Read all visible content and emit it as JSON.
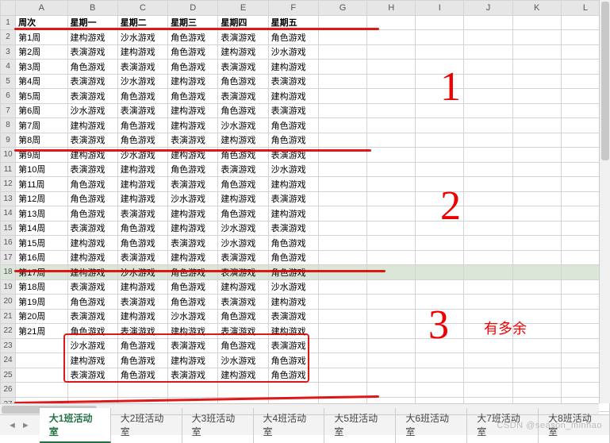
{
  "cols": [
    "",
    "A",
    "B",
    "C",
    "D",
    "E",
    "F",
    "G",
    "H",
    "I",
    "J",
    "K",
    "L"
  ],
  "hdr": {
    "A": "周次",
    "B": "星期一",
    "C": "星期二",
    "D": "星期三",
    "E": "星期四",
    "F": "星期五"
  },
  "rows": [
    {
      "n": 2,
      "A": "第1周",
      "B": "建构游戏",
      "C": "沙水游戏",
      "D": "角色游戏",
      "E": "表演游戏",
      "F": "角色游戏"
    },
    {
      "n": 3,
      "A": "第2周",
      "B": "表演游戏",
      "C": "建构游戏",
      "D": "角色游戏",
      "E": "建构游戏",
      "F": "沙水游戏"
    },
    {
      "n": 4,
      "A": "第3周",
      "B": "角色游戏",
      "C": "表演游戏",
      "D": "角色游戏",
      "E": "表演游戏",
      "F": "建构游戏"
    },
    {
      "n": 5,
      "A": "第4周",
      "B": "表演游戏",
      "C": "沙水游戏",
      "D": "建构游戏",
      "E": "角色游戏",
      "F": "表演游戏"
    },
    {
      "n": 6,
      "A": "第5周",
      "B": "表演游戏",
      "C": "角色游戏",
      "D": "角色游戏",
      "E": "表演游戏",
      "F": "建构游戏"
    },
    {
      "n": 7,
      "A": "第6周",
      "B": "沙水游戏",
      "C": "表演游戏",
      "D": "建构游戏",
      "E": "角色游戏",
      "F": "表演游戏"
    },
    {
      "n": 8,
      "A": "第7周",
      "B": "建构游戏",
      "C": "角色游戏",
      "D": "建构游戏",
      "E": "沙水游戏",
      "F": "角色游戏"
    },
    {
      "n": 9,
      "A": "第8周",
      "B": "表演游戏",
      "C": "角色游戏",
      "D": "表演游戏",
      "E": "建构游戏",
      "F": "角色游戏"
    },
    {
      "n": 10,
      "A": "第9周",
      "B": "建构游戏",
      "C": "沙水游戏",
      "D": "建构游戏",
      "E": "角色游戏",
      "F": "表演游戏"
    },
    {
      "n": 11,
      "A": "第10周",
      "B": "表演游戏",
      "C": "建构游戏",
      "D": "角色游戏",
      "E": "表演游戏",
      "F": "沙水游戏"
    },
    {
      "n": 12,
      "A": "第11周",
      "B": "角色游戏",
      "C": "建构游戏",
      "D": "表演游戏",
      "E": "角色游戏",
      "F": "建构游戏"
    },
    {
      "n": 13,
      "A": "第12周",
      "B": "角色游戏",
      "C": "建构游戏",
      "D": "沙水游戏",
      "E": "建构游戏",
      "F": "表演游戏"
    },
    {
      "n": 14,
      "A": "第13周",
      "B": "角色游戏",
      "C": "表演游戏",
      "D": "建构游戏",
      "E": "角色游戏",
      "F": "建构游戏"
    },
    {
      "n": 15,
      "A": "第14周",
      "B": "表演游戏",
      "C": "角色游戏",
      "D": "建构游戏",
      "E": "沙水游戏",
      "F": "表演游戏"
    },
    {
      "n": 16,
      "A": "第15周",
      "B": "建构游戏",
      "C": "角色游戏",
      "D": "表演游戏",
      "E": "沙水游戏",
      "F": "角色游戏"
    },
    {
      "n": 17,
      "A": "第16周",
      "B": "建构游戏",
      "C": "表演游戏",
      "D": "建构游戏",
      "E": "表演游戏",
      "F": "角色游戏"
    },
    {
      "n": 18,
      "A": "第17周",
      "B": "建构游戏",
      "C": "沙水游戏",
      "D": "角色游戏",
      "E": "表演游戏",
      "F": "角色游戏",
      "sel": true
    },
    {
      "n": 19,
      "A": "第18周",
      "B": "表演游戏",
      "C": "建构游戏",
      "D": "角色游戏",
      "E": "建构游戏",
      "F": "沙水游戏"
    },
    {
      "n": 20,
      "A": "第19周",
      "B": "角色游戏",
      "C": "表演游戏",
      "D": "角色游戏",
      "E": "表演游戏",
      "F": "建构游戏"
    },
    {
      "n": 21,
      "A": "第20周",
      "B": "表演游戏",
      "C": "建构游戏",
      "D": "沙水游戏",
      "E": "角色游戏",
      "F": "表演游戏"
    },
    {
      "n": 22,
      "A": "第21周",
      "B": "角色游戏",
      "C": "表演游戏",
      "D": "建构游戏",
      "E": "表演游戏",
      "F": "建构游戏"
    },
    {
      "n": 23,
      "A": "",
      "B": "沙水游戏",
      "C": "角色游戏",
      "D": "表演游戏",
      "E": "角色游戏",
      "F": "表演游戏"
    },
    {
      "n": 24,
      "A": "",
      "B": "建构游戏",
      "C": "角色游戏",
      "D": "建构游戏",
      "E": "沙水游戏",
      "F": "角色游戏"
    },
    {
      "n": 25,
      "A": "",
      "B": "表演游戏",
      "C": "角色游戏",
      "D": "表演游戏",
      "E": "建构游戏",
      "F": "角色游戏"
    },
    {
      "n": 26,
      "A": ""
    },
    {
      "n": 27,
      "A": ""
    }
  ],
  "tabs": [
    "大1班活动室",
    "大2班活动室",
    "大3班活动室",
    "大4班活动室",
    "大5班活动室",
    "大6班活动室",
    "大7班活动室",
    "大8班活动室"
  ],
  "activeTab": 0,
  "annotations": {
    "n1": "1",
    "n2": "2",
    "n3": "3",
    "label": "有多余"
  },
  "watermark": "CSDN @season_minhao"
}
